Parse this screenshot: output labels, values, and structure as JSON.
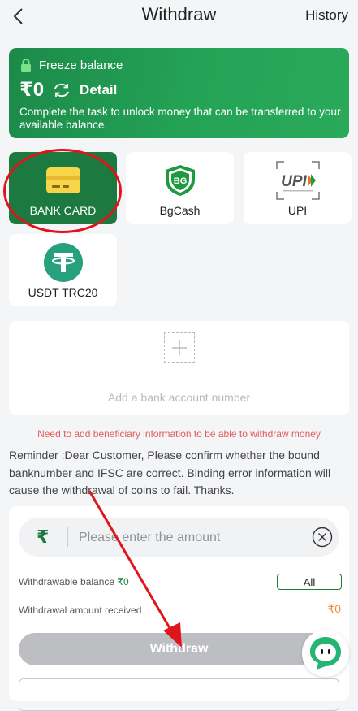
{
  "header": {
    "title": "Withdraw",
    "history_label": "History"
  },
  "balance": {
    "freeze_label": "Freeze balance",
    "amount": "₹0",
    "detail_label": "Detail",
    "note": "Complete the task to unlock money that can be transferred to your available balance."
  },
  "methods": [
    {
      "label": "BANK CARD",
      "icon": "bank-card-icon",
      "active": true
    },
    {
      "label": "BgCash",
      "icon": "bgcash-logo-icon",
      "active": false
    },
    {
      "label": "UPI",
      "icon": "upi-logo-icon",
      "active": false
    },
    {
      "label": "USDT TRC20",
      "icon": "tether-icon",
      "active": false
    }
  ],
  "upi_logo_text": "UPI",
  "bgcash_logo_text": "BG",
  "add_account": {
    "label": "Add a bank account number"
  },
  "warning": "Need to add beneficiary information to be able to withdraw money",
  "reminder": "Reminder :Dear Customer, Please confirm whether the bound banknumber and IFSC are correct. Binding error information will cause the withdrawal of coins to fail. Thanks.",
  "withdraw_form": {
    "currency_symbol": "₹",
    "amount_placeholder": "Please enter the amount",
    "amount_value": "",
    "withdrawable_label": "Withdrawable balance",
    "withdrawable_value": "₹0",
    "all_label": "All",
    "received_label": "Withdrawal amount received",
    "received_value": "₹0",
    "submit_label": "Withdraw"
  },
  "colors": {
    "brand_green": "#1c7a41",
    "card_gradient": "#24a356",
    "warning_red": "#e35b5b",
    "highlight_red": "#e0141b",
    "amount_orange": "#f08a3a"
  }
}
